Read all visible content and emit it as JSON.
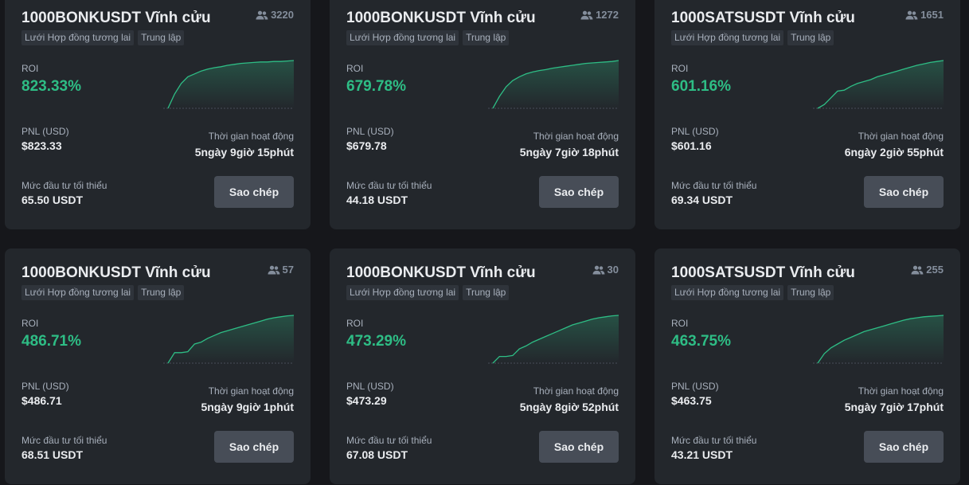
{
  "colors": {
    "background": "#16171b",
    "card": "#23272c",
    "positive": "#2ebd85",
    "button": "#474d57",
    "muted": "#a8b0bc"
  },
  "labels": {
    "roi": "ROI",
    "pnl": "PNL (USD)",
    "duration": "Thời gian hoạt động",
    "min_invest": "Mức đầu tư tối thiểu",
    "copy_button": "Sao chép"
  },
  "cards": [
    {
      "title": "1000BONKUSDT Vĩnh cửu",
      "followers": "3220",
      "tags": [
        "Lưới Hợp đồng tương lai",
        "Trung lập"
      ],
      "roi": "823.33%",
      "pnl": "$823.33",
      "duration": "5ngày 9giờ 15phút",
      "min_invest": "65.50 USDT",
      "trend": [
        0,
        0.3,
        0.52,
        0.66,
        0.72,
        0.78,
        0.82,
        0.85,
        0.87,
        0.9,
        0.92,
        0.94,
        0.95,
        0.96,
        0.97,
        0.97,
        0.98,
        0.98,
        0.99,
        1.0
      ]
    },
    {
      "title": "1000BONKUSDT Vĩnh cửu",
      "followers": "1272",
      "tags": [
        "Lưới Hợp đồng tương lai",
        "Trung lập"
      ],
      "roi": "679.78%",
      "pnl": "$679.78",
      "duration": "5ngày 7giờ 18phút",
      "min_invest": "44.18 USDT",
      "trend": [
        0,
        0.25,
        0.45,
        0.58,
        0.66,
        0.72,
        0.76,
        0.79,
        0.81,
        0.84,
        0.86,
        0.88,
        0.9,
        0.92,
        0.94,
        0.95,
        0.96,
        0.97,
        0.98,
        1.0
      ]
    },
    {
      "title": "1000SATSUSDT Vĩnh cửu",
      "followers": "1651",
      "tags": [
        "Lưới Hợp đồng tương lai",
        "Trung lập"
      ],
      "roi": "601.16%",
      "pnl": "$601.16",
      "duration": "6ngày 2giờ 55phút",
      "min_invest": "69.34 USDT",
      "trend": [
        0,
        0.08,
        0.22,
        0.36,
        0.38,
        0.46,
        0.52,
        0.56,
        0.6,
        0.66,
        0.7,
        0.74,
        0.78,
        0.82,
        0.86,
        0.9,
        0.93,
        0.96,
        0.98,
        1.0
      ]
    },
    {
      "title": "1000BONKUSDT Vĩnh cửu",
      "followers": "57",
      "tags": [
        "Lưới Hợp đồng tương lai",
        "Trung lập"
      ],
      "roi": "486.71%",
      "pnl": "$486.71",
      "duration": "5ngày 9giờ 1phút",
      "min_invest": "68.51 USDT",
      "trend": [
        0,
        0.22,
        0.22,
        0.24,
        0.4,
        0.44,
        0.52,
        0.58,
        0.64,
        0.68,
        0.72,
        0.76,
        0.8,
        0.84,
        0.88,
        0.92,
        0.95,
        0.97,
        0.99,
        1.0
      ]
    },
    {
      "title": "1000BONKUSDT Vĩnh cửu",
      "followers": "30",
      "tags": [
        "Lưới Hợp đồng tương lai",
        "Trung lập"
      ],
      "roi": "473.29%",
      "pnl": "$473.29",
      "duration": "5ngày 8giờ 52phút",
      "min_invest": "67.08 USDT",
      "trend": [
        0,
        0.14,
        0.14,
        0.16,
        0.3,
        0.36,
        0.44,
        0.5,
        0.56,
        0.62,
        0.68,
        0.74,
        0.8,
        0.84,
        0.88,
        0.92,
        0.95,
        0.97,
        0.99,
        1.0
      ]
    },
    {
      "title": "1000SATSUSDT Vĩnh cửu",
      "followers": "255",
      "tags": [
        "Lưới Hợp đồng tương lai",
        "Trung lập"
      ],
      "roi": "463.75%",
      "pnl": "$463.75",
      "duration": "5ngày 7giờ 17phút",
      "min_invest": "43.21 USDT",
      "trend": [
        0,
        0.2,
        0.32,
        0.4,
        0.48,
        0.54,
        0.6,
        0.66,
        0.7,
        0.74,
        0.78,
        0.82,
        0.86,
        0.9,
        0.93,
        0.95,
        0.97,
        0.98,
        0.99,
        1.0
      ]
    }
  ]
}
